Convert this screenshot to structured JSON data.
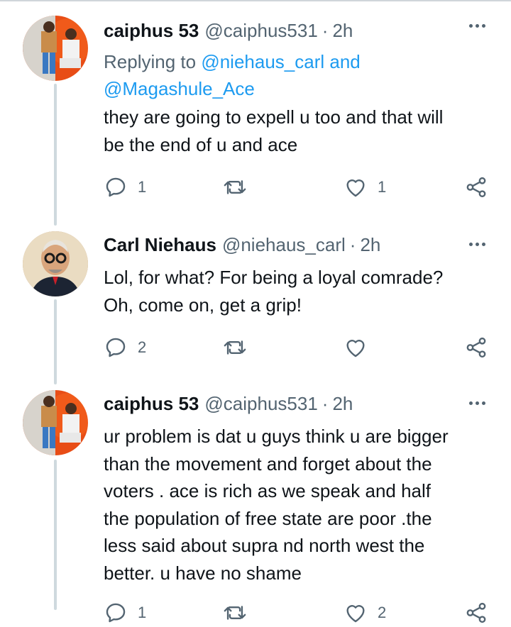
{
  "tweets": [
    {
      "name": "caiphus 53",
      "handle": "@caiphus531",
      "time": "2h",
      "replying_prefix": "Replying to",
      "mention1": "@niehaus_carl",
      "replying_and": "and",
      "mention2": "@Magashule_Ace",
      "body": [
        "they are going to expell u too and that will",
        "be the end of u and ace"
      ],
      "replies": "1",
      "retweets": "",
      "likes": "1"
    },
    {
      "name": "Carl Niehaus",
      "handle": "@niehaus_carl",
      "time": "2h",
      "body": [
        "Lol, for what? For being a loyal comrade?",
        "Oh, come on, get a grip!"
      ],
      "replies": "2",
      "retweets": "",
      "likes": ""
    },
    {
      "name": "caiphus 53",
      "handle": "@caiphus531",
      "time": "2h",
      "body": [
        "ur problem is dat u guys think u are bigger",
        "than the movement and forget about the",
        "voters . ace is rich as we speak and half",
        "the population of free state are poor .the",
        "less said about supra nd north west the",
        "better. u have no shame"
      ],
      "replies": "1",
      "retweets": "",
      "likes": "2"
    }
  ],
  "separator": "·",
  "icons": {
    "reply": "reply-icon",
    "retweet": "retweet-icon",
    "like": "heart-icon",
    "share": "share-icon",
    "more": "more-icon"
  },
  "colors": {
    "text": "#0f1419",
    "secondary": "#536471",
    "link": "#1d9bf0",
    "thread": "#cfd9de"
  }
}
